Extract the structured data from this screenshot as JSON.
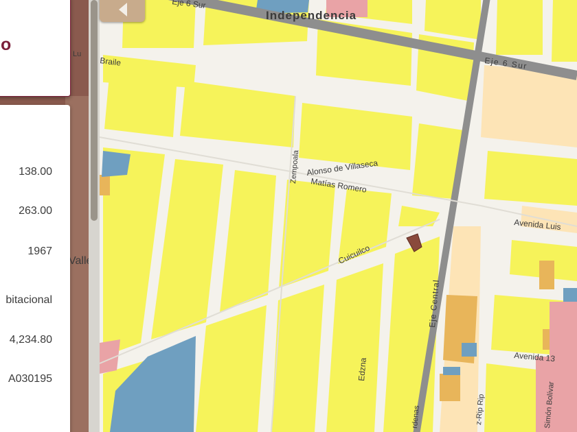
{
  "map": {
    "labels": {
      "independencia": "Independencia",
      "eje6sur_left": "Eje 6 Sur",
      "eje6sur_right": "Eje 6 Sur",
      "braille": "Braile",
      "zempoala": "Zempoala",
      "alonso": "Alonso de Villaseca",
      "matias": "Matías Romero",
      "cuicuilco": "Cuicuilco",
      "eje_central": "Eje Central",
      "edzna": "Edzna",
      "avenida_luis": "Avenida Luis",
      "avenida_13": "Avenida 13",
      "diaz_rip": "z-Rip Rip",
      "simon_bolivar": "Simón Bolívar",
      "cardenas": "rdenas",
      "left_valle": "Valle",
      "left_lu": "Lu"
    },
    "colors": {
      "residential": "#f6f35a",
      "street": "#f4f2ec",
      "eje_road": "#8e8e8e",
      "commercial_orange": "#e8b55a",
      "light_orange": "#fde4b6",
      "pink": "#e9a3a6",
      "blue": "#6f9fc0",
      "selected_parcel": "#8a4a3c"
    }
  },
  "panel": {
    "title_partial": "o",
    "values": {
      "v1": "138.00",
      "v2": "263.00",
      "v3": "1967",
      "v4": "bitacional",
      "v5": "4,234.80",
      "v6": "A030195"
    }
  },
  "nav": {
    "icon": "chevron-left-icon"
  }
}
